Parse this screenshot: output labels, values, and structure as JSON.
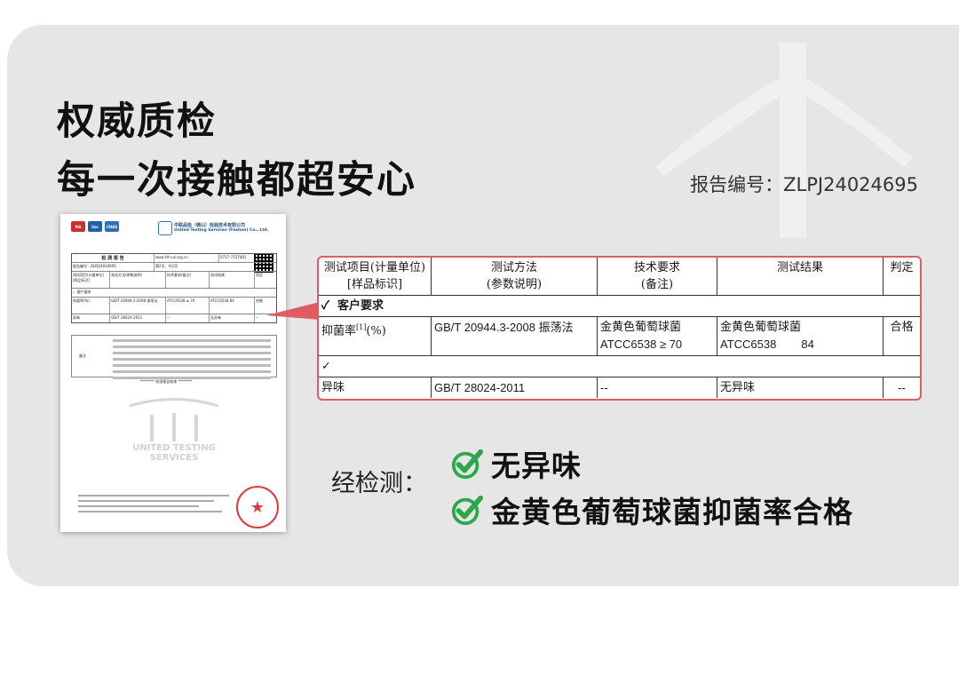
{
  "headline": {
    "line1": "权威质检",
    "line2": "每一次接触都超安心"
  },
  "report_number": "报告编号：ZLPJ24024695",
  "document": {
    "lab_name_cn": "中联品检（佛山）检验技术有限公司",
    "lab_name_en": "United Testing Services (Foshan) Co., Ltd.",
    "title": "检 测 报 告",
    "report_id": "报告编号：ZLPJ24024695",
    "website": "www.fsh-uz.org.cn",
    "phone": "0757-7157081",
    "page": "第2页，共2页",
    "col_item": "测试项目(计量单位)[样品标识]",
    "col_method": "测试方法(参数说明)",
    "col_req": "技术要求(备注)",
    "col_result": "测试结果",
    "col_judge": "判定",
    "row_customer": "✓ 客户要求",
    "row1_item": "抑菌率(%)",
    "row1_method": "GB/T 20944.3-2008 振荡法",
    "row1_req": "ATCC6538 ≥ 70",
    "row1_result": "ATCC6538   84",
    "row1_judge": "合格",
    "row2_item": "异味",
    "row2_method": "GB/T 28024-2011",
    "row2_req": "--",
    "row2_result": "无异味",
    "row2_judge": "--",
    "note_label": "备注",
    "end_text": "******** 检测报告结束 ********",
    "watermark": "UNITED TESTING SERVICES"
  },
  "table": {
    "headers": {
      "item": "测试项目(计量单位)",
      "item_sub": "[样品标识]",
      "method": "测试方法",
      "method_sub": "(参数说明)",
      "requirement": "技术要求",
      "requirement_sub": "(备注)",
      "result": "测试结果",
      "judgement": "判定"
    },
    "customer_row": "客户要求",
    "check_mark": "✓",
    "rows": [
      {
        "item": "抑菌率",
        "item_sup": "[1]",
        "item_unit": "(%)",
        "method": "GB/T 20944.3-2008 振荡法",
        "requirement_line1": "金黄色葡萄球菌",
        "requirement_line2": "ATCC6538 ≥ 70",
        "result_line1": "金黄色葡萄球菌",
        "result_strain": "ATCC6538",
        "result_value": "84",
        "judgement": "合格"
      },
      {
        "item": "异味",
        "method": "GB/T 28024-2011",
        "requirement": "--",
        "result": "无异味",
        "judgement": "--"
      }
    ]
  },
  "conclusion": {
    "label": "经检测：",
    "items": [
      "无异味",
      "金黄色葡萄球菌抑菌率合格"
    ]
  },
  "colors": {
    "card_bg": "#e6e6e6",
    "highlight_border": "#e05b62",
    "check_green": "#2aa84a"
  }
}
